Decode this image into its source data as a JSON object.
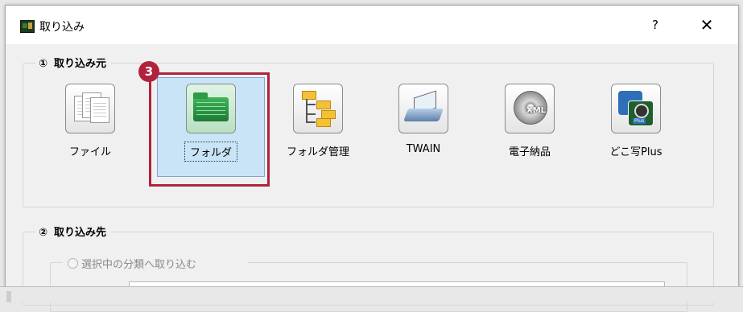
{
  "window": {
    "title": "取り込み",
    "help_label": "?",
    "close_label": "✕"
  },
  "source_group": {
    "number": "①",
    "label": "取り込み元",
    "items": [
      {
        "label": "ファイル",
        "icon": "documents-icon"
      },
      {
        "label": "フォルダ",
        "icon": "folder-icon",
        "selected": true
      },
      {
        "label": "フォルダ管理",
        "icon": "folder-tree-icon"
      },
      {
        "label": "TWAIN",
        "icon": "scanner-icon"
      },
      {
        "label": "電子納品",
        "icon": "xml-disc-icon"
      },
      {
        "label": "どこ写Plus",
        "icon": "camera-plus-icon"
      }
    ]
  },
  "step_badge": "3",
  "dest_group": {
    "number": "②",
    "label": "取り込み先",
    "radio_label": "選択中の分類へ取り込む"
  },
  "colors": {
    "highlight": "#b0223c",
    "selection": "#c9e4f7"
  }
}
